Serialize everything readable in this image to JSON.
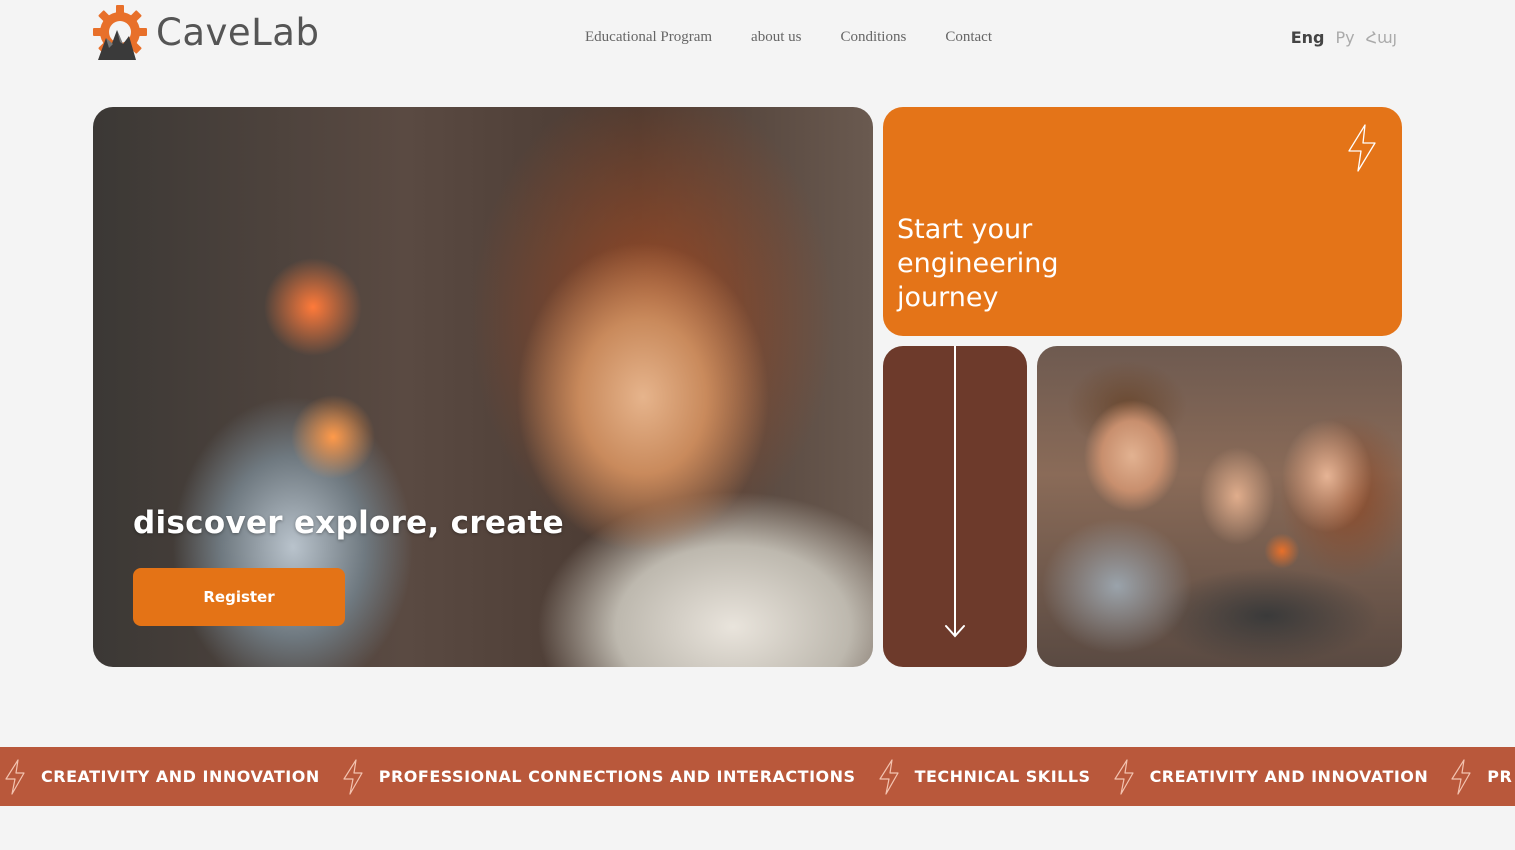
{
  "header": {
    "brand": "CaveLab",
    "nav": [
      "Educational Program",
      "about us",
      "Conditions",
      "Contact"
    ],
    "languages": [
      {
        "label": "Eng",
        "active": true
      },
      {
        "label": "Ру",
        "active": false
      },
      {
        "label": "Հայ",
        "active": false
      }
    ]
  },
  "hero": {
    "title": "discover explore, create",
    "register_label": "Register"
  },
  "promo": {
    "text": "Start your engineering journey"
  },
  "ticker": {
    "items": [
      "CREATIVITY AND INNOVATION",
      "PROFESSIONAL CONNECTIONS AND INTERACTIONS",
      "TECHNICAL SKILLS",
      "CREATIVITY AND INNOVATION",
      "PR"
    ]
  },
  "icons": {
    "logo": "gear-cave-logo-icon",
    "promo": "lightning-bolt-icon",
    "scroll": "arrow-down-icon",
    "ticker": "lightning-bolt-icon"
  },
  "colors": {
    "accent": "#e47316",
    "brown_card": "#6d3a2b",
    "ticker_bg": "#b9583b",
    "background": "#f4f4f4"
  }
}
